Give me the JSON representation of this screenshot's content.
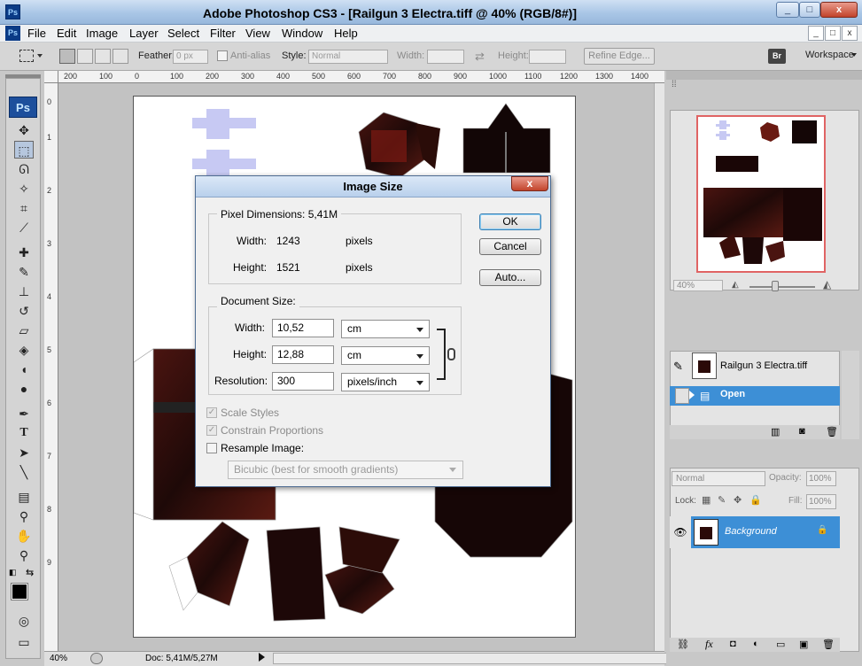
{
  "app": {
    "title": "Adobe Photoshop CS3 - [Railgun 3 Electra.tiff @ 40% (RGB/8#)]",
    "ps_logo": "Ps",
    "window_buttons": [
      "_",
      "□",
      "x"
    ],
    "mdi_buttons": [
      "_",
      "□",
      "x"
    ]
  },
  "menu": [
    "File",
    "Edit",
    "Image",
    "Layer",
    "Select",
    "Filter",
    "View",
    "Window",
    "Help"
  ],
  "options": {
    "feather_label": "Feather:",
    "feather_value": "0 px",
    "antialias_label": "Anti-alias",
    "style_label": "Style:",
    "style_value": "Normal",
    "width_label": "Width:",
    "height_label": "Height:",
    "refine_edge": "Refine Edge...",
    "bridge": "Br",
    "workspace": "Workspace"
  },
  "rulers": {
    "h": [
      "200",
      "100",
      "0",
      "100",
      "200",
      "300",
      "400",
      "500",
      "600",
      "700",
      "800",
      "900",
      "1000",
      "1100",
      "1200",
      "1300",
      "1400"
    ],
    "v": [
      "0",
      "1",
      "2",
      "3",
      "4",
      "5",
      "6",
      "7",
      "8",
      "9"
    ]
  },
  "dialog": {
    "title": "Image Size",
    "close": "x",
    "pixel_dimensions_label": "Pixel Dimensions:",
    "pixel_dimensions_value": "5,41M",
    "px_width_label": "Width:",
    "px_width_value": "1243",
    "px_width_unit": "pixels",
    "px_height_label": "Height:",
    "px_height_value": "1521",
    "px_height_unit": "pixels",
    "document_size_label": "Document Size:",
    "doc_width_label": "Width:",
    "doc_width_value": "10,52",
    "doc_width_unit": "cm",
    "doc_height_label": "Height:",
    "doc_height_value": "12,88",
    "doc_height_unit": "cm",
    "resolution_label": "Resolution:",
    "resolution_value": "300",
    "resolution_unit": "pixels/inch",
    "scale_styles": "Scale Styles",
    "constrain_proportions": "Constrain Proportions",
    "resample_image": "Resample Image:",
    "resample_method": "Bicubic (best for smooth gradients)",
    "ok": "OK",
    "cancel": "Cancel",
    "auto": "Auto..."
  },
  "navigator": {
    "zoom": "40%"
  },
  "history": {
    "snapshot": "Railgun 3 Electra.tiff",
    "state": "Open"
  },
  "layers": {
    "blend_mode": "Normal",
    "opacity_label": "Opacity:",
    "opacity_value": "100%",
    "lock_label": "Lock:",
    "fill_label": "Fill:",
    "fill_value": "100%",
    "layer_name": "Background"
  },
  "status": {
    "zoom": "40%",
    "doc": "Doc: 5,41M/5,27M"
  },
  "colors": {
    "accent": "#3d8fd6",
    "dialog_title": "#c6d9f0"
  }
}
